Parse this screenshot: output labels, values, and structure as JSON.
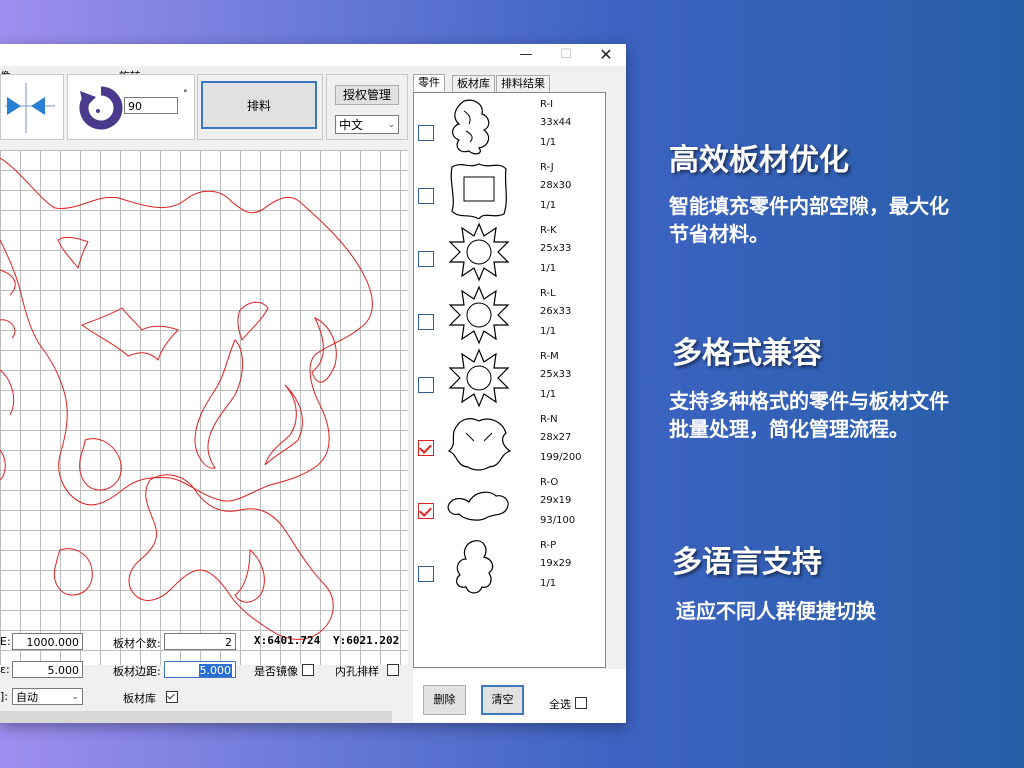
{
  "toolbar": {
    "mirror_label": "像",
    "rotate_label": "旋转",
    "rotate_value": "90",
    "rotate_unit": "°",
    "nest_button": "排料",
    "license_button": "授权管理",
    "language_value": "中文"
  },
  "tabs": [
    "零件",
    "板材库",
    "排料结果"
  ],
  "parts": [
    {
      "name": "R-I",
      "size": "33x44",
      "count": "1/1",
      "checked": false
    },
    {
      "name": "R-J",
      "size": "28x30",
      "count": "1/1",
      "checked": false
    },
    {
      "name": "R-K",
      "size": "25x33",
      "count": "1/1",
      "checked": false
    },
    {
      "name": "R-L",
      "size": "26x33",
      "count": "1/1",
      "checked": false
    },
    {
      "name": "R-M",
      "size": "25x33",
      "count": "1/1",
      "checked": false
    },
    {
      "name": "R-N",
      "size": "28x27",
      "count": "199/200",
      "checked": true
    },
    {
      "name": "R-O",
      "size": "29x19",
      "count": "93/100",
      "checked": true
    },
    {
      "name": "R-P",
      "size": "19x29",
      "count": "1/1",
      "checked": false
    }
  ],
  "bottom": {
    "field1_label": "E:",
    "field1_value": "1000.000",
    "field2_label": "ɛ:",
    "field2_value": "5.000",
    "field3_label": "]:",
    "mode_value": "自动",
    "sheet_count_label": "板材个数:",
    "sheet_count_value": "2",
    "coord_x": "X:6401.724",
    "coord_y": "Y:6021.202",
    "sheet_margin_label": "板材边距:",
    "sheet_margin_value": "5.000",
    "mirror_check_label": "是否镜像",
    "inner_hole_label": "内孔排样",
    "sheet_lib_label": "板材库",
    "delete_button": "删除",
    "clear_button": "清空",
    "select_all_label": "全选"
  },
  "features": [
    {
      "title": "高效板材优化",
      "desc_lines": [
        "智能填充零件内部空隙，最大化",
        "节省材料。"
      ]
    },
    {
      "title": "多格式兼容",
      "desc_lines": [
        "支持多种格式的零件与板材文件",
        "批量处理，简化管理流程。"
      ]
    },
    {
      "title": "多语言支持",
      "desc_lines": [
        "适应不同人群便捷切换"
      ]
    }
  ],
  "colors": {
    "cut_path": "#e02020",
    "accent_check": "#d22222"
  }
}
